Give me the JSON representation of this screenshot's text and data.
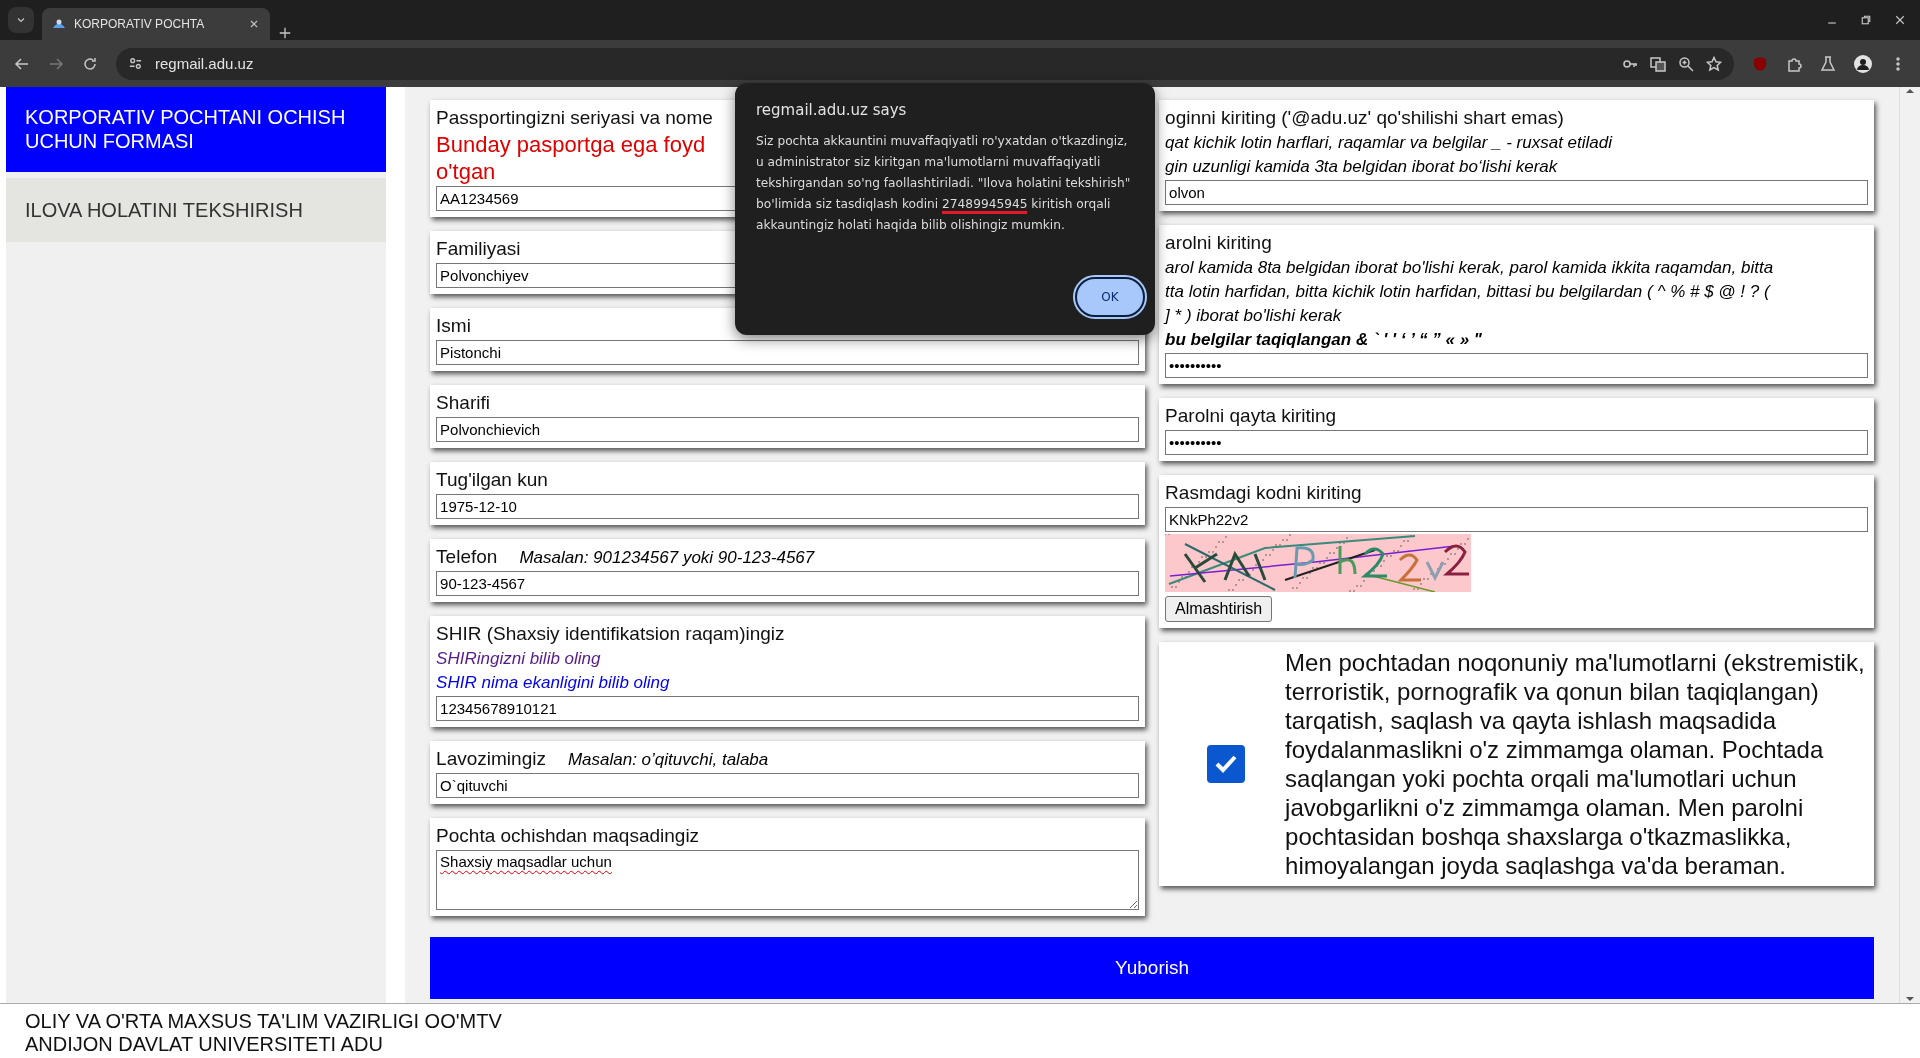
{
  "browser": {
    "tab_title": "KORPORATIV POCHTA",
    "url": "regmail.adu.uz"
  },
  "sidebar": {
    "items": [
      {
        "label": "KORPORATIV POCHTANI OCHISH UCHUN FORMASI",
        "selected": true
      },
      {
        "label": "ILOVA HOLATINI TEKSHIRISH",
        "selected": false
      }
    ]
  },
  "left_fields": [
    {
      "kind": "input",
      "label": "Passportingizni seriyasi va nome",
      "errors": [
        "Bunday pasportga ega foyd",
        "o'tgan"
      ],
      "value": "AA1234569"
    },
    {
      "kind": "input",
      "label": "Familiyasi",
      "value": "Polvonchiyev"
    },
    {
      "kind": "input",
      "label": "Ismi",
      "value": "Pistonchi"
    },
    {
      "kind": "input",
      "label": "Sharifi",
      "value": "Polvonchievich"
    },
    {
      "kind": "input",
      "label": "Tug'ilgan kun",
      "value": "1975-12-10"
    },
    {
      "kind": "input",
      "label": "Telefon",
      "inline_hint": "Masalan: 901234567 yoki 90-123-4567",
      "value": "90-123-4567"
    },
    {
      "kind": "input",
      "label": "SHIR (Shaxsiy identifikatsion raqam)ingiz",
      "hints": [
        {
          "kind": "link",
          "text": "SHIRingizni bilib oling",
          "visited": true
        },
        {
          "kind": "link",
          "text": "SHIR nima ekanligini bilib oling",
          "visited": false
        }
      ],
      "value": "12345678910121"
    },
    {
      "kind": "input",
      "label": "Lavozimingiz",
      "inline_hint": "Masalan: o’qituvchi, talaba",
      "value": "O`qituvchi"
    },
    {
      "kind": "textarea",
      "label": "Pochta ochishdan maqsadingiz",
      "value": "Shaxsiy maqsadlar uchun"
    }
  ],
  "right_fields": [
    {
      "kind": "input",
      "label": "oginni kiriting ('@adu.uz' qo'shilishi shart emas)",
      "hints": [
        {
          "kind": "note",
          "text": "qat kichik lotin harflari, raqamlar va belgilar _ - ruxsat etiladi"
        },
        {
          "kind": "note",
          "text": "gin uzunligi kamida 3ta belgidan iborat bo‘lishi kerak"
        }
      ],
      "value": "olvon"
    },
    {
      "kind": "input",
      "label": "arolni kiriting",
      "hints": [
        {
          "kind": "note",
          "text": "arol kamida 8ta belgidan iborat bo'lishi kerak, parol kamida ikkita raqamdan, bitta"
        },
        {
          "kind": "note",
          "text": "tta lotin harfidan, bitta kichik lotin harfidan, bittasi bu belgilardan ( ^ % # $ @ ! ? ("
        },
        {
          "kind": "note",
          "text": "] * ) iborat bo'lishi kerak"
        },
        {
          "kind": "warning",
          "text": "bu belgilar taqiqlangan & ` ' ' ‘ ’ “ ” « » \""
        }
      ],
      "value": "••••••••••"
    },
    {
      "kind": "input",
      "label": "Parolni qayta kiriting",
      "value": "••••••••••"
    },
    {
      "kind": "captcha",
      "label": "Rasmdagi kodni kiriting",
      "value": "KNkPh22v2",
      "button": "Almashtirish"
    }
  ],
  "agreement": {
    "checked": true,
    "text": "Men pochtadan noqonuniy ma'lumotlarni (ekstremistik, terroristik, pornografik va qonun bilan taqiqlangan) tarqatish, saqlash va qayta ishlash maqsadida foydalanmaslikni o'z zimmamga olaman. Pochtada saqlangan yoki pochta orqali ma'lumotlari uchun javobgarlikni o'z zimmamga olaman. Men parolni pochtasidan boshqa shaxslarga o'tkazmaslikka, himoyalangan joyda saqlashga va'da beraman."
  },
  "submit": "Yuborish",
  "footer": [
    "OLIY VA O'RTA MAXSUS TA'LIM VAZIRLIGI OO'MTV",
    "ANDIJON DAVLAT UNIVERSITETI ADU"
  ],
  "dialog": {
    "title": "regmail.adu.uz says",
    "message_before": "Siz pochta akkauntini muvaffaqiyatli ro'yxatdan o'tkazdingiz, u administrator siz kiritgan ma'lumotlarni muvaffaqiyatli tekshirgandan so'ng faollashtiriladi. \"Ilova holatini tekshirish\" bo'limida siz tasdiqlash kodini ",
    "code": "27489945945",
    "message_after": " kiritish orqali akkauntingiz holati haqida bilib olishingiz mumkin.",
    "button": "OK"
  }
}
